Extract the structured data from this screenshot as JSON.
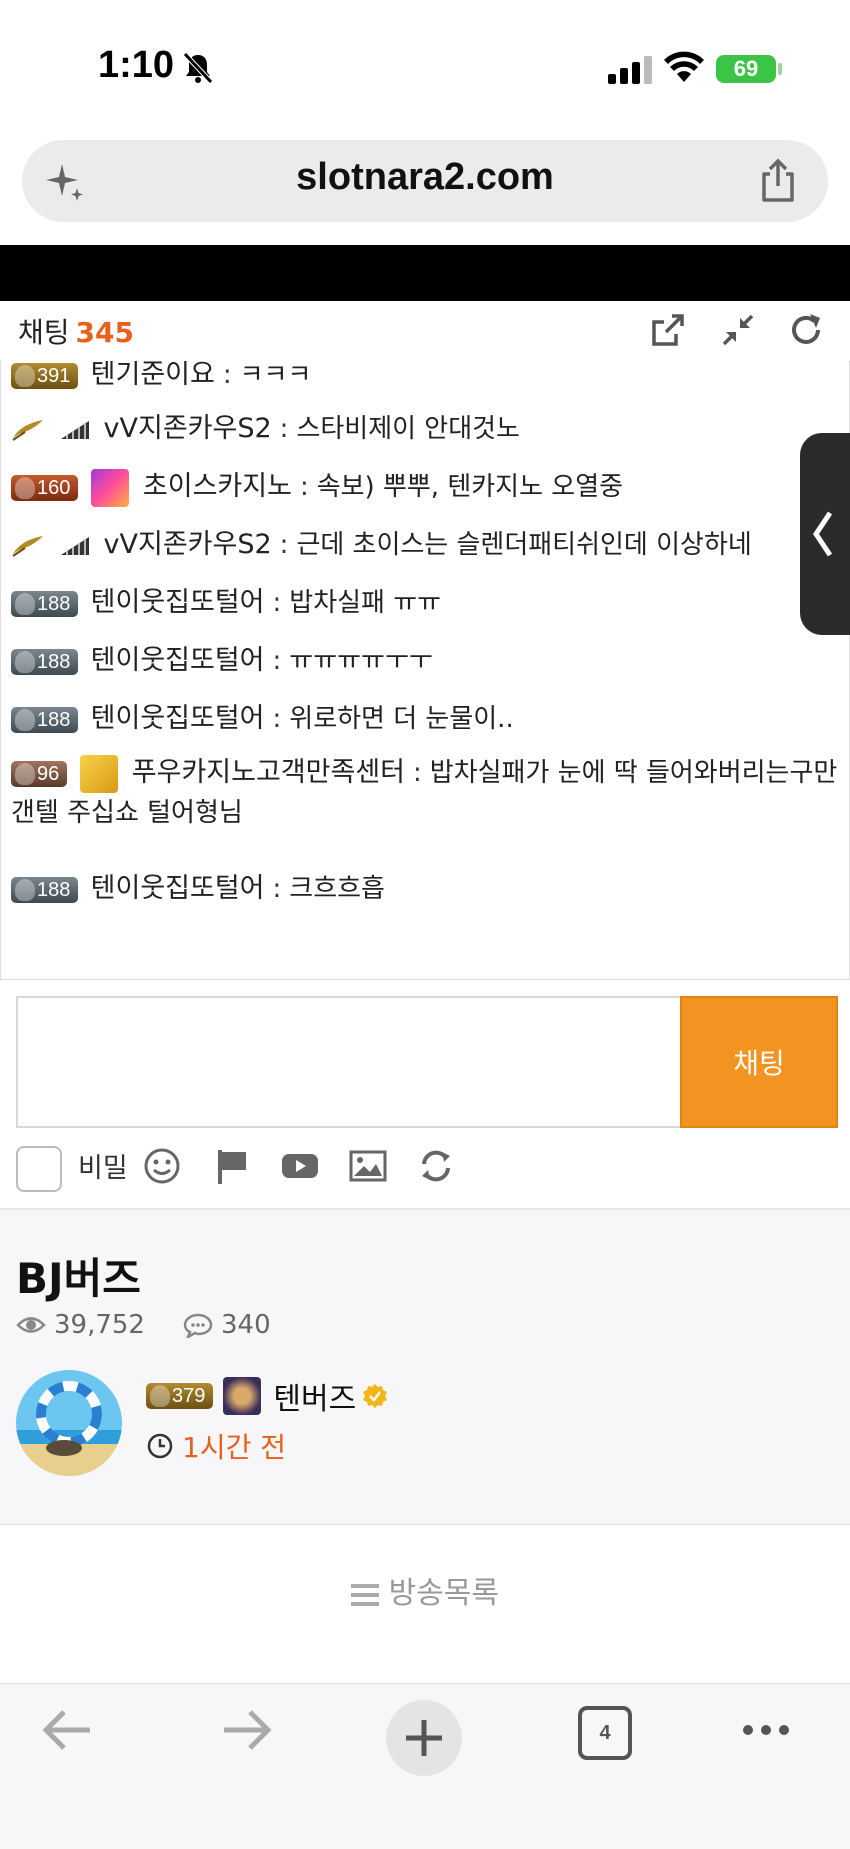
{
  "status_bar": {
    "time": "1:10",
    "battery": "69"
  },
  "browser": {
    "url": "slotnara2.com",
    "tabs_count": "4"
  },
  "chat": {
    "title": "채팅",
    "count": "345",
    "partial_top": {
      "level": "391",
      "nick": "텐기준이요",
      "text": "ㅋㅋㅋ"
    },
    "messages": [
      {
        "badge": "feather",
        "level": "",
        "nick": "vV지존카우S2",
        "text": "스타비제이 안대것노"
      },
      {
        "badge": "red",
        "level": "160",
        "nick": "초이스카지노",
        "text": "속보) 뿌뿌, 텐카지노 오열중"
      },
      {
        "badge": "feather",
        "level": "",
        "nick": "vV지존카우S2",
        "text": "근데 초이스는 슬렌더패티쉬인데 이상하네"
      },
      {
        "badge": "silver",
        "level": "188",
        "nick": "텐이웃집또털어",
        "text": "밥차실패 ㅠㅠ"
      },
      {
        "badge": "silver",
        "level": "188",
        "nick": "텐이웃집또털어",
        "text": "ㅠㅠㅠㅠㅜㅜ"
      },
      {
        "badge": "silver",
        "level": "188",
        "nick": "텐이웃집또털어",
        "text": "위로하면 더 눈물이.."
      },
      {
        "badge": "brown",
        "level": "96",
        "nick": "푸우카지노고객만족센터",
        "text": "밥차실패가 눈에 딱 들어와버리는구만 갠텔 주십쇼 털어형님"
      },
      {
        "badge": "silver",
        "level": "188",
        "nick": "텐이웃집또털어",
        "text": "크흐흐흡"
      }
    ],
    "send_label": "채팅",
    "secret_label": "비밀"
  },
  "post": {
    "title": "BJ버즈",
    "views": "39,752",
    "comments": "340",
    "author_level": "379",
    "author": "텐버즈",
    "time_ago": "1시간 전",
    "list_link": "방송목록"
  },
  "colors": {
    "accent": "#e8601c",
    "send_button": "#f29322",
    "battery": "#3cc447"
  }
}
